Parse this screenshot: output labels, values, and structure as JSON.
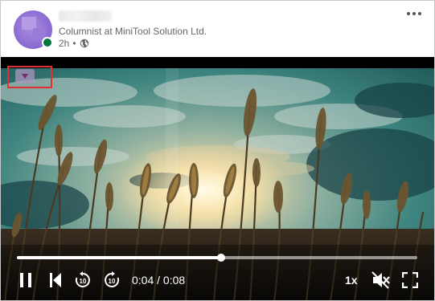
{
  "post": {
    "subtitle": "Columnist at MiniTool Solution Ltd.",
    "age": "2h",
    "separator": "•",
    "visibility_icon": "globe-icon",
    "more_icon": "more-horizontal-icon"
  },
  "video": {
    "current_time": "0:04",
    "time_separator": " / ",
    "duration": "0:08",
    "progress_fraction": 0.51,
    "speed_label": "1x",
    "muted": true,
    "controls": [
      "pause-icon",
      "skip-to-start-icon",
      "rewind-10-icon",
      "forward-10-icon",
      "mute-icon",
      "fullscreen-icon"
    ],
    "rewind_seconds": "10",
    "forward_seconds": "10",
    "highlight_color": "#e03030"
  }
}
